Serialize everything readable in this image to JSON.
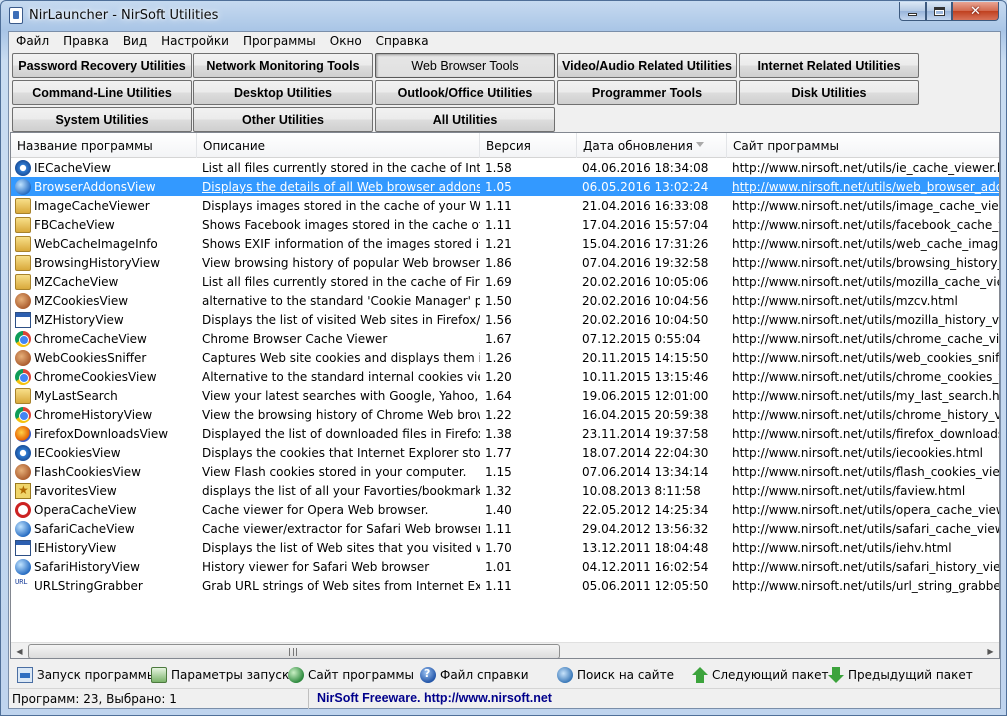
{
  "window": {
    "title": "NirLauncher  -  NirSoft Utilities"
  },
  "menu": [
    "Файл",
    "Правка",
    "Вид",
    "Настройки",
    "Программы",
    "Окно",
    "Справка"
  ],
  "categories": [
    {
      "label": "Password Recovery Utilities",
      "active": false
    },
    {
      "label": "Network Monitoring Tools",
      "active": false
    },
    {
      "label": "Web Browser Tools",
      "active": true
    },
    {
      "label": "Video/Audio Related Utilities",
      "active": false
    },
    {
      "label": "Internet Related Utilities",
      "active": false
    },
    {
      "label": "Command-Line Utilities",
      "active": false
    },
    {
      "label": "Desktop Utilities",
      "active": false
    },
    {
      "label": "Outlook/Office Utilities",
      "active": false
    },
    {
      "label": "Programmer Tools",
      "active": false
    },
    {
      "label": "Disk Utilities",
      "active": false
    },
    {
      "label": "System Utilities",
      "active": false
    },
    {
      "label": "Other Utilities",
      "active": false
    },
    {
      "label": "All Utilities",
      "active": false
    }
  ],
  "columns": [
    "Название программы",
    "Описание",
    "Версия",
    "Дата обновления",
    "Сайт программы"
  ],
  "rows": [
    {
      "name": "IECacheView",
      "icon": "ie-icon",
      "desc": "List all files currently stored in the cache of Intern...",
      "ver": "1.58",
      "date": "04.06.2016 18:34:08",
      "url": "http://www.nirsoft.net/utils/ie_cache_viewer.html",
      "selected": false
    },
    {
      "name": "BrowserAddonsView",
      "icon": "globe-icon",
      "desc": "Displays the details of all Web browser addons/pl...",
      "ver": "1.05",
      "date": "06.05.2016 13:02:24",
      "url": "http://www.nirsoft.net/utils/web_browser_addon...",
      "selected": true
    },
    {
      "name": "ImageCacheViewer",
      "icon": "folder-icon",
      "desc": "Displays images stored in the cache of your Web ...",
      "ver": "1.11",
      "date": "21.04.2016 16:33:08",
      "url": "http://www.nirsoft.net/utils/image_cache_viewer...",
      "selected": false
    },
    {
      "name": "FBCacheView",
      "icon": "folder-icon",
      "desc": "Shows Facebook images stored in the cache of yo...",
      "ver": "1.11",
      "date": "17.04.2016 15:57:04",
      "url": "http://www.nirsoft.net/utils/facebook_cache_vie...",
      "selected": false
    },
    {
      "name": "WebCacheImageInfo",
      "icon": "folder-icon",
      "desc": "Shows EXIF information of the images stored in ...",
      "ver": "1.21",
      "date": "15.04.2016 17:31:26",
      "url": "http://www.nirsoft.net/utils/web_cache_image_i...",
      "selected": false
    },
    {
      "name": "BrowsingHistoryView",
      "icon": "folder-icon",
      "desc": "View browsing history of popular Web browsers",
      "ver": "1.86",
      "date": "07.04.2016 19:32:58",
      "url": "http://www.nirsoft.net/utils/browsing_history_vi...",
      "selected": false
    },
    {
      "name": "MZCacheView",
      "icon": "folder-icon",
      "desc": "List all files currently stored in the cache of Firefox...",
      "ver": "1.69",
      "date": "20.02.2016 10:05:06",
      "url": "http://www.nirsoft.net/utils/mozilla_cache_viewe...",
      "selected": false
    },
    {
      "name": "MZCookiesView",
      "icon": "cookie-icon",
      "desc": "alternative to the standard 'Cookie Manager' prov...",
      "ver": "1.50",
      "date": "20.02.2016 10:04:56",
      "url": "http://www.nirsoft.net/utils/mzcv.html",
      "selected": false
    },
    {
      "name": "MZHistoryView",
      "icon": "window-icon",
      "desc": "Displays the list of visited Web sites in Firefox/Mo...",
      "ver": "1.56",
      "date": "20.02.2016 10:04:50",
      "url": "http://www.nirsoft.net/utils/mozilla_history_view...",
      "selected": false
    },
    {
      "name": "ChromeCacheView",
      "icon": "chrome-icon",
      "desc": "Chrome Browser Cache Viewer",
      "ver": "1.67",
      "date": "07.12.2015 0:55:04",
      "url": "http://www.nirsoft.net/utils/chrome_cache_view...",
      "selected": false
    },
    {
      "name": "WebCookiesSniffer",
      "icon": "cookie-icon",
      "desc": "Captures Web site cookies and displays them in a ...",
      "ver": "1.26",
      "date": "20.11.2015 14:15:50",
      "url": "http://www.nirsoft.net/utils/web_cookies_sniffer...",
      "selected": false
    },
    {
      "name": "ChromeCookiesView",
      "icon": "chrome-icon",
      "desc": "Alternative to the standard internal cookies viewe...",
      "ver": "1.20",
      "date": "10.11.2015 13:15:46",
      "url": "http://www.nirsoft.net/utils/chrome_cookies_vie...",
      "selected": false
    },
    {
      "name": "MyLastSearch",
      "icon": "folder-icon",
      "desc": "View your latest searches with Google, Yahoo, an...",
      "ver": "1.64",
      "date": "19.06.2015 12:01:00",
      "url": "http://www.nirsoft.net/utils/my_last_search.html",
      "selected": false
    },
    {
      "name": "ChromeHistoryView",
      "icon": "chrome-icon",
      "desc": "View the browsing history of Chrome Web browser",
      "ver": "1.22",
      "date": "16.04.2015 20:59:38",
      "url": "http://www.nirsoft.net/utils/chrome_history_vie...",
      "selected": false
    },
    {
      "name": "FirefoxDownloadsView",
      "icon": "firefox-icon",
      "desc": "Displayed the list of downloaded files in Firefox",
      "ver": "1.38",
      "date": "23.11.2014 19:37:58",
      "url": "http://www.nirsoft.net/utils/firefox_downloads_v...",
      "selected": false
    },
    {
      "name": "IECookiesView",
      "icon": "ie-icon",
      "desc": "Displays the cookies that Internet Explorer stores ...",
      "ver": "1.77",
      "date": "18.07.2014 22:04:30",
      "url": "http://www.nirsoft.net/utils/iecookies.html",
      "selected": false
    },
    {
      "name": "FlashCookiesView",
      "icon": "cookie-icon",
      "desc": "View Flash cookies stored in your computer.",
      "ver": "1.15",
      "date": "07.06.2014 13:34:14",
      "url": "http://www.nirsoft.net/utils/flash_cookies_view.h...",
      "selected": false
    },
    {
      "name": "FavoritesView",
      "icon": "star-icon",
      "desc": "displays the list of all your Favorties/bookmarks i...",
      "ver": "1.32",
      "date": "10.08.2013 8:11:58",
      "url": "http://www.nirsoft.net/utils/faview.html",
      "selected": false
    },
    {
      "name": "OperaCacheView",
      "icon": "opera-icon",
      "desc": "Cache viewer for Opera Web browser.",
      "ver": "1.40",
      "date": "22.05.2012 14:25:34",
      "url": "http://www.nirsoft.net/utils/opera_cache_view.ht...",
      "selected": false
    },
    {
      "name": "SafariCacheView",
      "icon": "globe-icon",
      "desc": "Cache viewer/extractor for Safari Web browser",
      "ver": "1.11",
      "date": "29.04.2012 13:56:32",
      "url": "http://www.nirsoft.net/utils/safari_cache_view.ht...",
      "selected": false
    },
    {
      "name": "IEHistoryView",
      "icon": "window-icon",
      "desc": "Displays the list of Web sites that you visited with ...",
      "ver": "1.70",
      "date": "13.12.2011 18:04:48",
      "url": "http://www.nirsoft.net/utils/iehv.html",
      "selected": false
    },
    {
      "name": "SafariHistoryView",
      "icon": "globe-icon",
      "desc": "History viewer for Safari Web browser",
      "ver": "1.01",
      "date": "04.12.2011 16:02:54",
      "url": "http://www.nirsoft.net/utils/safari_history_view.h...",
      "selected": false
    },
    {
      "name": "URLStringGrabber",
      "icon": "url-icon",
      "desc": "Grab URL strings of Web sites from Internet Explor...",
      "ver": "1.11",
      "date": "05.06.2011 12:05:50",
      "url": "http://www.nirsoft.net/utils/url_string_grabber.ht...",
      "selected": false
    }
  ],
  "toolbar": {
    "launch": "Запуск программы",
    "params": "Параметры запуска",
    "website": "Сайт программы",
    "help": "Файл справки",
    "search": "Поиск на сайте",
    "next": "Следующий пакет",
    "prev": "Предыдущий пакет"
  },
  "status": {
    "count": "Программ: 23, Выбрано: 1",
    "link": "NirSoft Freeware.  http://www.nirsoft.net"
  },
  "colors": {
    "selection": "#3399ff",
    "status_link": "#00008b"
  }
}
